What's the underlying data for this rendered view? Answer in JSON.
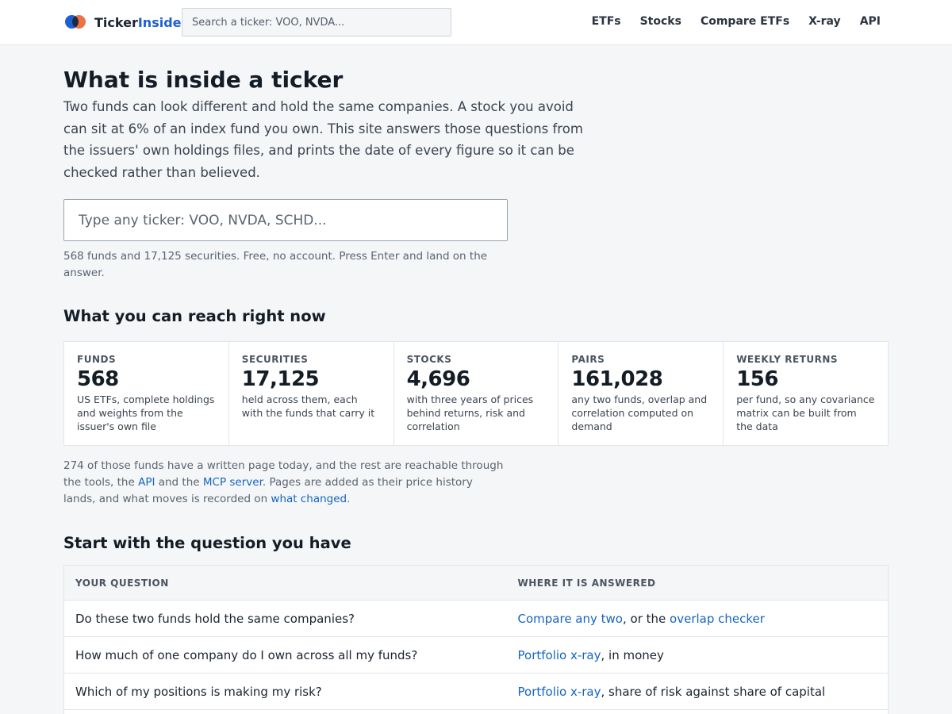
{
  "header": {
    "brand_prefix": "Ticker",
    "brand_accent": "Inside",
    "search_placeholder": "Search a ticker: VOO, NVDA...",
    "nav": [
      {
        "label": "ETFs"
      },
      {
        "label": "Stocks"
      },
      {
        "label": "Compare ETFs"
      },
      {
        "label": "X-ray"
      },
      {
        "label": "API"
      }
    ]
  },
  "hero": {
    "title": "What is inside a ticker",
    "lede": "Two funds can look different and hold the same companies. A stock you avoid can sit at 6% of an index fund you own. This site answers those questions from the issuers' own holdings files, and prints the date of every figure so it can be checked rather than believed.",
    "search_placeholder": "Type any ticker: VOO, NVDA, SCHD...",
    "note": "568 funds and 17,125 securities. Free, no account. Press Enter and land on the answer."
  },
  "reach": {
    "heading": "What you can reach right now",
    "stats": [
      {
        "label": "FUNDS",
        "value": "568",
        "desc": "US ETFs, complete holdings and weights from the issuer's own file"
      },
      {
        "label": "SECURITIES",
        "value": "17,125",
        "desc": "held across them, each with the funds that carry it"
      },
      {
        "label": "STOCKS",
        "value": "4,696",
        "desc": "with three years of prices behind returns, risk and correlation"
      },
      {
        "label": "PAIRS",
        "value": "161,028",
        "desc": "any two funds, overlap and correlation computed on demand"
      },
      {
        "label": "WEEKLY RETURNS",
        "value": "156",
        "desc": "per fund, so any covariance matrix can be built from the data"
      }
    ],
    "after_text_1": "274 of those funds have a written page today, and the rest are reachable through the tools, the ",
    "after_link_api": "API",
    "after_text_2": " and the ",
    "after_link_mcp": "MCP server",
    "after_text_3": ". Pages are added as their price history lands, and what moves is recorded on ",
    "after_link_changed": "what changed",
    "after_text_4": "."
  },
  "questions": {
    "heading": "Start with the question you have",
    "col_question": "YOUR QUESTION",
    "col_answer": "WHERE IT IS ANSWERED",
    "rows": [
      {
        "question": "Do these two funds hold the same companies?",
        "link1": "Compare any two",
        "mid": ", or the ",
        "link2": "overlap checker",
        "tail": ""
      },
      {
        "question": "How much of one company do I own across all my funds?",
        "link1": "Portfolio x-ray",
        "mid": ", in money",
        "link2": "",
        "tail": ""
      },
      {
        "question": "Which of my positions is making my risk?",
        "link1": "Portfolio x-ray",
        "mid": ", share of risk against share of capital",
        "link2": "",
        "tail": ""
      }
    ]
  }
}
